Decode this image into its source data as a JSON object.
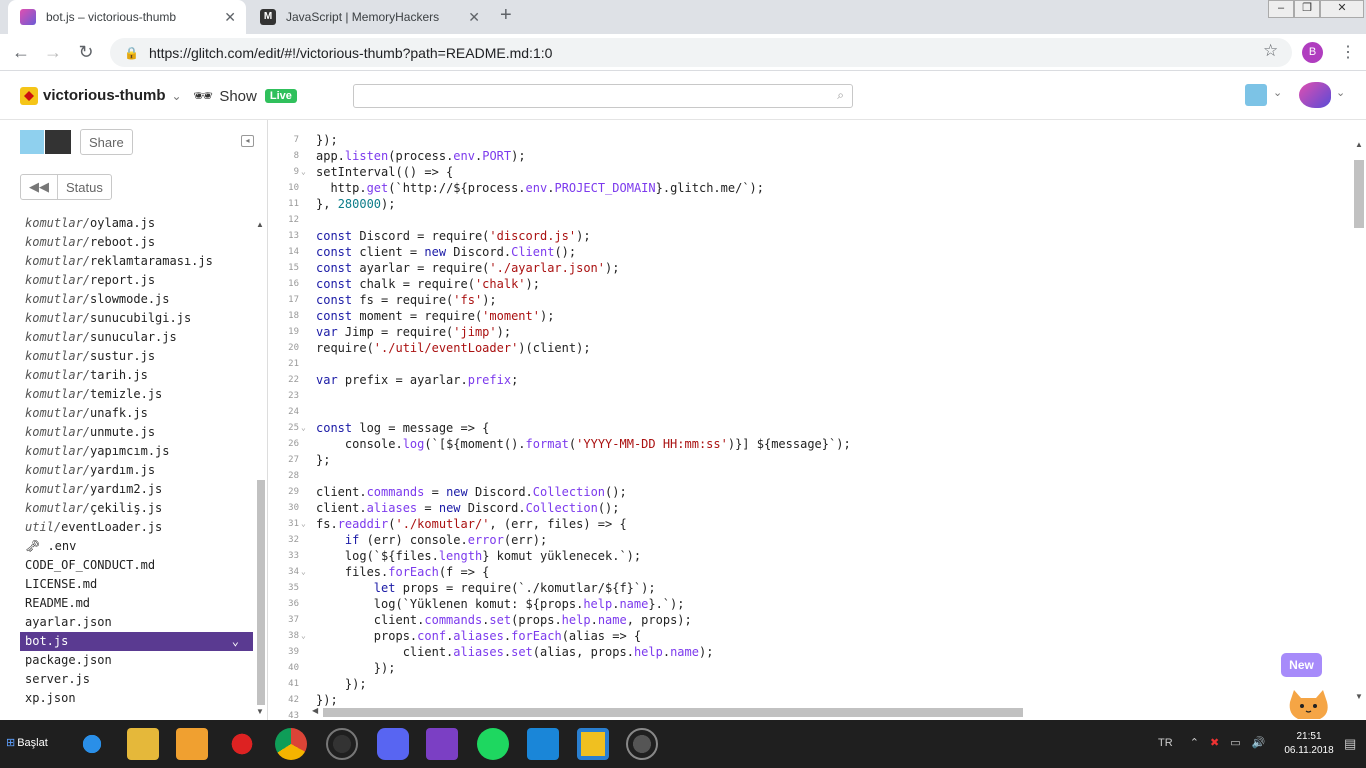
{
  "browser": {
    "tabs": [
      {
        "title": "bot.js – victorious-thumb",
        "active": true
      },
      {
        "title": "JavaScript | MemoryHackers",
        "active": false
      }
    ],
    "new_tab": "+",
    "url": "https://glitch.com/edit/#!/victorious-thumb?path=README.md:1:0",
    "profile_initial": "B"
  },
  "glitch": {
    "project_name": "victorious-thumb",
    "show_label": "Show",
    "live_badge": "Live",
    "search_value": "",
    "share_label": "Share",
    "status_label": "Status"
  },
  "files": [
    {
      "dir": "komutlar/",
      "name": "oylama.js"
    },
    {
      "dir": "komutlar/",
      "name": "reboot.js"
    },
    {
      "dir": "komutlar/",
      "name": "reklamtaraması.js"
    },
    {
      "dir": "komutlar/",
      "name": "report.js"
    },
    {
      "dir": "komutlar/",
      "name": "slowmode.js"
    },
    {
      "dir": "komutlar/",
      "name": "sunucubilgi.js"
    },
    {
      "dir": "komutlar/",
      "name": "sunucular.js"
    },
    {
      "dir": "komutlar/",
      "name": "sustur.js"
    },
    {
      "dir": "komutlar/",
      "name": "tarih.js"
    },
    {
      "dir": "komutlar/",
      "name": "temizle.js"
    },
    {
      "dir": "komutlar/",
      "name": "unafk.js"
    },
    {
      "dir": "komutlar/",
      "name": "unmute.js"
    },
    {
      "dir": "komutlar/",
      "name": "yapımcım.js"
    },
    {
      "dir": "komutlar/",
      "name": "yardım.js"
    },
    {
      "dir": "komutlar/",
      "name": "yardım2.js"
    },
    {
      "dir": "komutlar/",
      "name": "çekiliş.js"
    },
    {
      "dir": "util/",
      "name": "eventLoader.js"
    },
    {
      "dir": "",
      "name": "🗝 .env"
    },
    {
      "dir": "",
      "name": "CODE_OF_CONDUCT.md"
    },
    {
      "dir": "",
      "name": "LICENSE.md"
    },
    {
      "dir": "",
      "name": "README.md"
    },
    {
      "dir": "",
      "name": "ayarlar.json"
    },
    {
      "dir": "",
      "name": "bot.js",
      "active": true
    },
    {
      "dir": "",
      "name": "package.json"
    },
    {
      "dir": "",
      "name": "server.js"
    },
    {
      "dir": "",
      "name": "xp.json"
    }
  ],
  "code_lines": [
    {
      "n": "7",
      "f": "",
      "t": "});"
    },
    {
      "n": "8",
      "f": "",
      "t": "app.listen(process.env.PORT);"
    },
    {
      "n": "9",
      "f": "⌄",
      "t": "setInterval(() => {"
    },
    {
      "n": "10",
      "f": "",
      "t": "  http.get(`http://${process.env.PROJECT_DOMAIN}.glitch.me/`);"
    },
    {
      "n": "11",
      "f": "",
      "t": "}, 280000);"
    },
    {
      "n": "12",
      "f": "",
      "t": ""
    },
    {
      "n": "13",
      "f": "",
      "t": "const Discord = require('discord.js');"
    },
    {
      "n": "14",
      "f": "",
      "t": "const client = new Discord.Client();"
    },
    {
      "n": "15",
      "f": "",
      "t": "const ayarlar = require('./ayarlar.json');"
    },
    {
      "n": "16",
      "f": "",
      "t": "const chalk = require('chalk');"
    },
    {
      "n": "17",
      "f": "",
      "t": "const fs = require('fs');"
    },
    {
      "n": "18",
      "f": "",
      "t": "const moment = require('moment');"
    },
    {
      "n": "19",
      "f": "",
      "t": "var Jimp = require('jimp');"
    },
    {
      "n": "20",
      "f": "",
      "t": "require('./util/eventLoader')(client);"
    },
    {
      "n": "21",
      "f": "",
      "t": ""
    },
    {
      "n": "22",
      "f": "",
      "t": "var prefix = ayarlar.prefix;"
    },
    {
      "n": "23",
      "f": "",
      "t": ""
    },
    {
      "n": "24",
      "f": "",
      "t": ""
    },
    {
      "n": "25",
      "f": "⌄",
      "t": "const log = message => {"
    },
    {
      "n": "26",
      "f": "",
      "t": "    console.log(`[${moment().format('YYYY-MM-DD HH:mm:ss')}] ${message}`);"
    },
    {
      "n": "27",
      "f": "",
      "t": "};"
    },
    {
      "n": "28",
      "f": "",
      "t": ""
    },
    {
      "n": "29",
      "f": "",
      "t": "client.commands = new Discord.Collection();"
    },
    {
      "n": "30",
      "f": "",
      "t": "client.aliases = new Discord.Collection();"
    },
    {
      "n": "31",
      "f": "⌄",
      "t": "fs.readdir('./komutlar/', (err, files) => {"
    },
    {
      "n": "32",
      "f": "",
      "t": "    if (err) console.error(err);"
    },
    {
      "n": "33",
      "f": "",
      "t": "    log(`${files.length} komut yüklenecek.`);"
    },
    {
      "n": "34",
      "f": "⌄",
      "t": "    files.forEach(f => {"
    },
    {
      "n": "35",
      "f": "",
      "t": "        let props = require(`./komutlar/${f}`);"
    },
    {
      "n": "36",
      "f": "",
      "t": "        log(`Yüklenen komut: ${props.help.name}.`);"
    },
    {
      "n": "37",
      "f": "",
      "t": "        client.commands.set(props.help.name, props);"
    },
    {
      "n": "38",
      "f": "⌄",
      "t": "        props.conf.aliases.forEach(alias => {"
    },
    {
      "n": "39",
      "f": "",
      "t": "            client.aliases.set(alias, props.help.name);"
    },
    {
      "n": "40",
      "f": "",
      "t": "        });"
    },
    {
      "n": "41",
      "f": "",
      "t": "    });"
    },
    {
      "n": "42",
      "f": "",
      "t": "});"
    },
    {
      "n": "43",
      "f": "",
      "t": ""
    }
  ],
  "new_badge": "New",
  "taskbar": {
    "start_label": "Başlat",
    "lang": "TR",
    "time": "21:51",
    "date": "06.11.2018",
    "apps": [
      "internet-explorer-icon",
      "file-explorer-icon",
      "media-player-icon",
      "settings-gear-icon",
      "chrome-icon",
      "steam-icon",
      "discord-icon",
      "visual-studio-icon",
      "spotify-icon",
      "vscode-icon",
      "window-app-icon",
      "steam-alt-icon"
    ]
  },
  "colors": {
    "accent": "#5a3a91",
    "live": "#30c05c",
    "new_badge": "#a78bfa"
  }
}
